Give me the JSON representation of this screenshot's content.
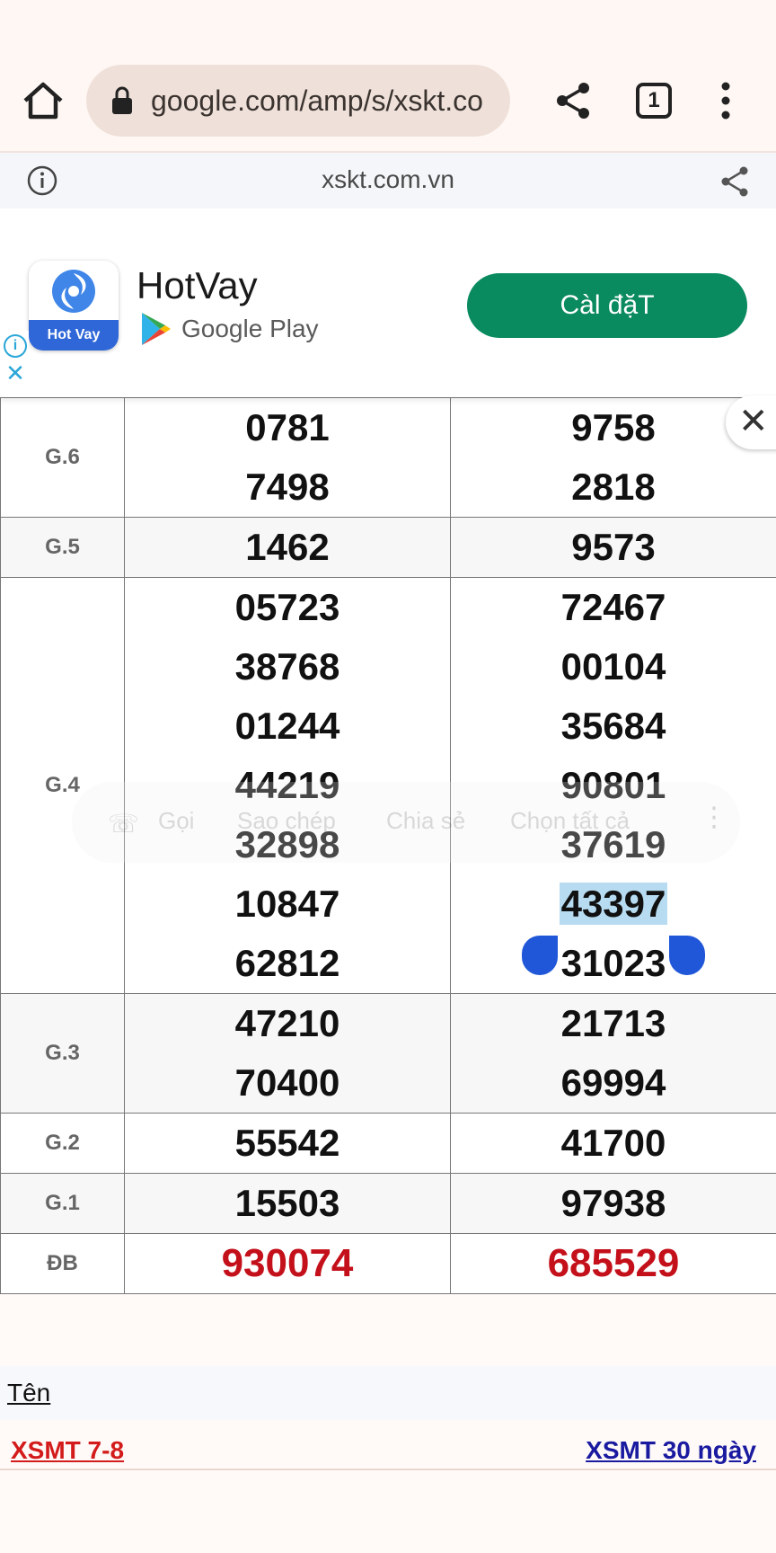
{
  "browser": {
    "url": "google.com/amp/s/xskt.co",
    "tab_count": "1"
  },
  "amp_header": {
    "domain": "xskt.com.vn"
  },
  "ad": {
    "app_name": "HotVay",
    "icon_label": "Hot Vay",
    "store": "Google Play",
    "install_label": "Càl đặT",
    "choice_info": "i",
    "choice_close": "✕"
  },
  "close_label": "✕",
  "results": {
    "rows": [
      {
        "label": "G.6",
        "col1": [
          "0781",
          "7498"
        ],
        "col2": [
          "9758",
          "2818"
        ],
        "style": "white"
      },
      {
        "label": "G.5",
        "col1": [
          "1462"
        ],
        "col2": [
          "9573"
        ],
        "style": "alt"
      },
      {
        "label": "G.4",
        "col1": [
          "05723",
          "38768",
          "01244",
          "44219",
          "32898",
          "10847",
          "62812"
        ],
        "col2": [
          "72467",
          "00104",
          "35684",
          "90801",
          "37619",
          "43397",
          "31023"
        ],
        "style": "white"
      },
      {
        "label": "G.3",
        "col1": [
          "47210",
          "70400"
        ],
        "col2": [
          "21713",
          "69994"
        ],
        "style": "alt"
      },
      {
        "label": "G.2",
        "col1": [
          "55542"
        ],
        "col2": [
          "41700"
        ],
        "style": "white"
      },
      {
        "label": "G.1",
        "col1": [
          "15503"
        ],
        "col2": [
          "97938"
        ],
        "style": "alt"
      },
      {
        "label": "ĐB",
        "col1": [
          "930074"
        ],
        "col2": [
          "685529"
        ],
        "style": "white",
        "special": true
      }
    ]
  },
  "context_menu": {
    "items": [
      "Gọi",
      "Sao chép",
      "Chia sẻ",
      "Chọn tất cả"
    ]
  },
  "footer": {
    "name_label": "Tên",
    "link_left": "XSMT 7-8",
    "link_right": "XSMT 30 ngày"
  }
}
